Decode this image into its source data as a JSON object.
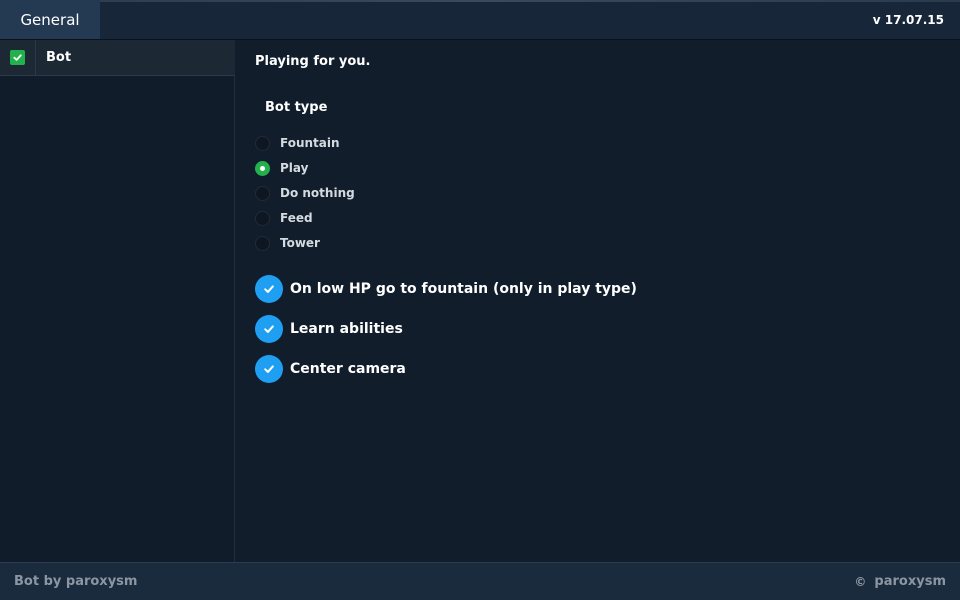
{
  "header": {
    "tab_label": "General",
    "version": "v 17.07.15"
  },
  "sidebar": {
    "items": [
      {
        "label": "Bot",
        "checked": true
      }
    ]
  },
  "main": {
    "subtitle": "Playing for you.",
    "bot_type": {
      "title": "Bot type",
      "selected": "Play",
      "options": [
        "Fountain",
        "Play",
        "Do nothing",
        "Feed",
        "Tower"
      ]
    },
    "checkboxes": [
      {
        "label": "On low HP go to fountain (only in play type)",
        "checked": true
      },
      {
        "label": "Learn abilities",
        "checked": true
      },
      {
        "label": "Center camera",
        "checked": true
      }
    ]
  },
  "footer": {
    "left": "Bot by paroxysm",
    "copyright_symbol": "©",
    "right": "paroxysm"
  },
  "colors": {
    "background": "#111d2b",
    "accent_green": "#22b14c",
    "accent_blue": "#1e9ff2"
  }
}
